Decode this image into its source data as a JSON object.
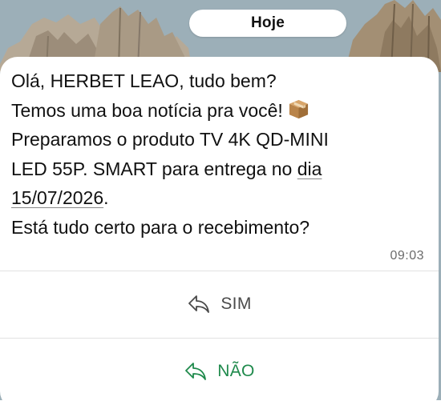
{
  "date_chip": {
    "label": "Hoje"
  },
  "message": {
    "lines": [
      "Olá, HERBET LEAO, tudo bem?",
      "Temos uma boa notícia pra você!",
      "Preparamos o produto TV 4K QD-MINI",
      "LED 55P. SMART para entrega no ",
      "dia",
      "15/07/2026",
      ".",
      "Está tudo certo para o recebimento?"
    ],
    "emoji": "package-icon",
    "time": "09:03"
  },
  "replies": [
    {
      "label": "SIM",
      "icon": "reply-arrow-icon",
      "color": "#4a4a4a"
    },
    {
      "label": "NÃO",
      "icon": "reply-arrow-icon",
      "color": "#1f8a4c"
    }
  ]
}
